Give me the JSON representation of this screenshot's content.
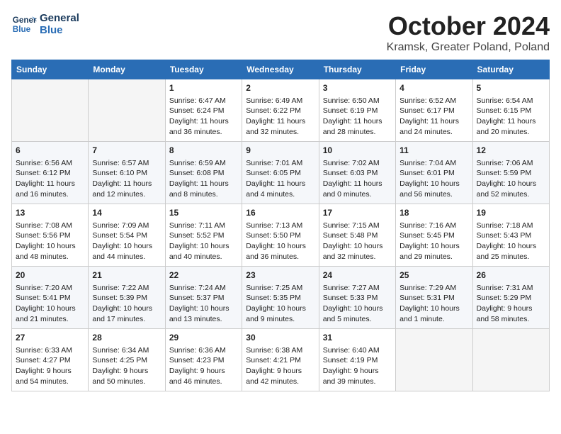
{
  "header": {
    "logo_line1": "General",
    "logo_line2": "Blue",
    "month": "October 2024",
    "location": "Kramsk, Greater Poland, Poland"
  },
  "weekdays": [
    "Sunday",
    "Monday",
    "Tuesday",
    "Wednesday",
    "Thursday",
    "Friday",
    "Saturday"
  ],
  "weeks": [
    [
      {
        "day": "",
        "data": ""
      },
      {
        "day": "",
        "data": ""
      },
      {
        "day": "1",
        "data": "Sunrise: 6:47 AM\nSunset: 6:24 PM\nDaylight: 11 hours\nand 36 minutes."
      },
      {
        "day": "2",
        "data": "Sunrise: 6:49 AM\nSunset: 6:22 PM\nDaylight: 11 hours\nand 32 minutes."
      },
      {
        "day": "3",
        "data": "Sunrise: 6:50 AM\nSunset: 6:19 PM\nDaylight: 11 hours\nand 28 minutes."
      },
      {
        "day": "4",
        "data": "Sunrise: 6:52 AM\nSunset: 6:17 PM\nDaylight: 11 hours\nand 24 minutes."
      },
      {
        "day": "5",
        "data": "Sunrise: 6:54 AM\nSunset: 6:15 PM\nDaylight: 11 hours\nand 20 minutes."
      }
    ],
    [
      {
        "day": "6",
        "data": "Sunrise: 6:56 AM\nSunset: 6:12 PM\nDaylight: 11 hours\nand 16 minutes."
      },
      {
        "day": "7",
        "data": "Sunrise: 6:57 AM\nSunset: 6:10 PM\nDaylight: 11 hours\nand 12 minutes."
      },
      {
        "day": "8",
        "data": "Sunrise: 6:59 AM\nSunset: 6:08 PM\nDaylight: 11 hours\nand 8 minutes."
      },
      {
        "day": "9",
        "data": "Sunrise: 7:01 AM\nSunset: 6:05 PM\nDaylight: 11 hours\nand 4 minutes."
      },
      {
        "day": "10",
        "data": "Sunrise: 7:02 AM\nSunset: 6:03 PM\nDaylight: 11 hours\nand 0 minutes."
      },
      {
        "day": "11",
        "data": "Sunrise: 7:04 AM\nSunset: 6:01 PM\nDaylight: 10 hours\nand 56 minutes."
      },
      {
        "day": "12",
        "data": "Sunrise: 7:06 AM\nSunset: 5:59 PM\nDaylight: 10 hours\nand 52 minutes."
      }
    ],
    [
      {
        "day": "13",
        "data": "Sunrise: 7:08 AM\nSunset: 5:56 PM\nDaylight: 10 hours\nand 48 minutes."
      },
      {
        "day": "14",
        "data": "Sunrise: 7:09 AM\nSunset: 5:54 PM\nDaylight: 10 hours\nand 44 minutes."
      },
      {
        "day": "15",
        "data": "Sunrise: 7:11 AM\nSunset: 5:52 PM\nDaylight: 10 hours\nand 40 minutes."
      },
      {
        "day": "16",
        "data": "Sunrise: 7:13 AM\nSunset: 5:50 PM\nDaylight: 10 hours\nand 36 minutes."
      },
      {
        "day": "17",
        "data": "Sunrise: 7:15 AM\nSunset: 5:48 PM\nDaylight: 10 hours\nand 32 minutes."
      },
      {
        "day": "18",
        "data": "Sunrise: 7:16 AM\nSunset: 5:45 PM\nDaylight: 10 hours\nand 29 minutes."
      },
      {
        "day": "19",
        "data": "Sunrise: 7:18 AM\nSunset: 5:43 PM\nDaylight: 10 hours\nand 25 minutes."
      }
    ],
    [
      {
        "day": "20",
        "data": "Sunrise: 7:20 AM\nSunset: 5:41 PM\nDaylight: 10 hours\nand 21 minutes."
      },
      {
        "day": "21",
        "data": "Sunrise: 7:22 AM\nSunset: 5:39 PM\nDaylight: 10 hours\nand 17 minutes."
      },
      {
        "day": "22",
        "data": "Sunrise: 7:24 AM\nSunset: 5:37 PM\nDaylight: 10 hours\nand 13 minutes."
      },
      {
        "day": "23",
        "data": "Sunrise: 7:25 AM\nSunset: 5:35 PM\nDaylight: 10 hours\nand 9 minutes."
      },
      {
        "day": "24",
        "data": "Sunrise: 7:27 AM\nSunset: 5:33 PM\nDaylight: 10 hours\nand 5 minutes."
      },
      {
        "day": "25",
        "data": "Sunrise: 7:29 AM\nSunset: 5:31 PM\nDaylight: 10 hours\nand 1 minute."
      },
      {
        "day": "26",
        "data": "Sunrise: 7:31 AM\nSunset: 5:29 PM\nDaylight: 9 hours\nand 58 minutes."
      }
    ],
    [
      {
        "day": "27",
        "data": "Sunrise: 6:33 AM\nSunset: 4:27 PM\nDaylight: 9 hours\nand 54 minutes."
      },
      {
        "day": "28",
        "data": "Sunrise: 6:34 AM\nSunset: 4:25 PM\nDaylight: 9 hours\nand 50 minutes."
      },
      {
        "day": "29",
        "data": "Sunrise: 6:36 AM\nSunset: 4:23 PM\nDaylight: 9 hours\nand 46 minutes."
      },
      {
        "day": "30",
        "data": "Sunrise: 6:38 AM\nSunset: 4:21 PM\nDaylight: 9 hours\nand 42 minutes."
      },
      {
        "day": "31",
        "data": "Sunrise: 6:40 AM\nSunset: 4:19 PM\nDaylight: 9 hours\nand 39 minutes."
      },
      {
        "day": "",
        "data": ""
      },
      {
        "day": "",
        "data": ""
      }
    ]
  ]
}
